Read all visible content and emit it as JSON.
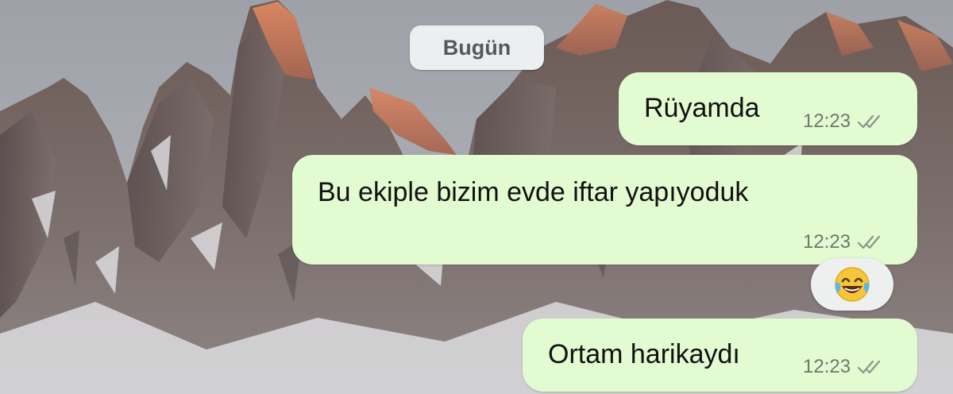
{
  "date_divider": "Bugün",
  "messages": [
    {
      "text": "Rüyamda",
      "time": "12:23",
      "status": "read"
    },
    {
      "text": "Bu ekiple bizim evde iftar yapıyoduk",
      "time": "12:23",
      "status": "read"
    },
    {
      "text": "Ortam harikaydı",
      "time": "12:23",
      "status": "read"
    }
  ],
  "reaction": {
    "emoji": "tears-of-joy"
  },
  "colors": {
    "outgoing_bubble": "#e2fbd1",
    "date_pill": "#eceef0",
    "tick": "#8a958b"
  },
  "icons": {
    "ticks": "double-check-icon",
    "reaction": "tears-of-joy-emoji-icon"
  },
  "background": "snowy-mountain-wallpaper"
}
